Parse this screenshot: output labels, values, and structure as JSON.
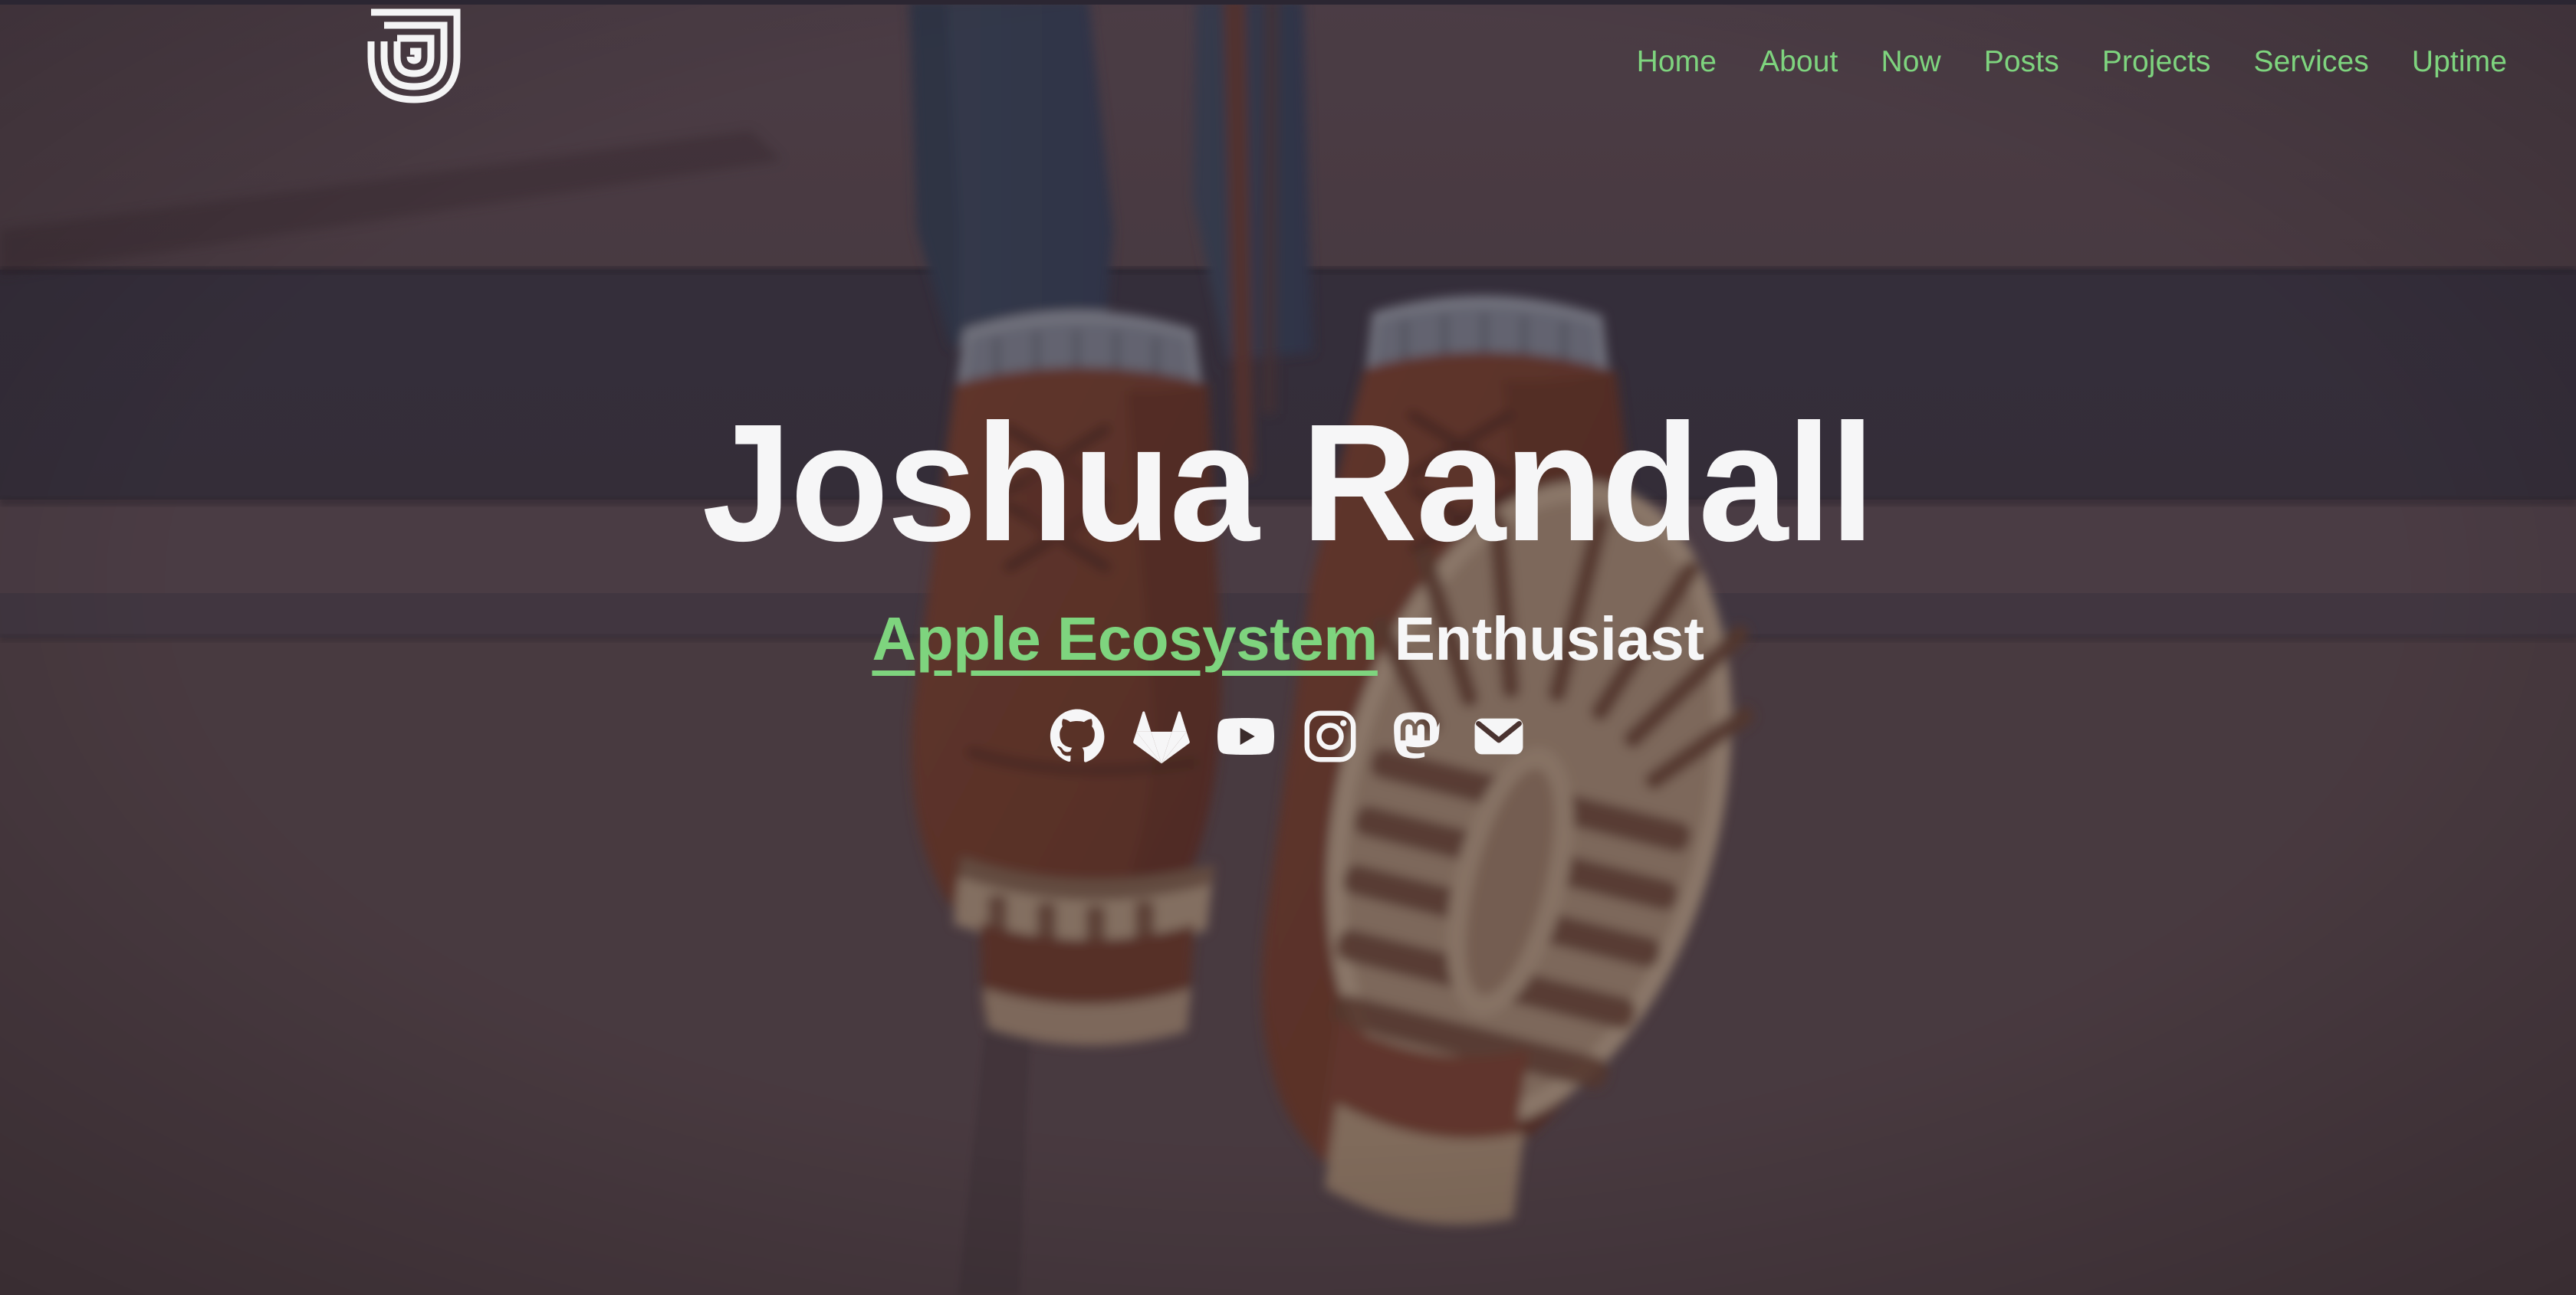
{
  "site": {
    "logo_icon": "j-monogram-logo",
    "accent_green": "#7ed47e",
    "text_white": "#f6f6f7",
    "background_overlay": "#564750"
  },
  "nav": {
    "items": [
      {
        "label": "Home"
      },
      {
        "label": "About"
      },
      {
        "label": "Now"
      },
      {
        "label": "Posts"
      },
      {
        "label": "Projects"
      },
      {
        "label": "Services"
      },
      {
        "label": "Uptime"
      }
    ]
  },
  "hero": {
    "name": "Joshua Randall",
    "tagline_link": "Apple Ecosystem",
    "tagline_rest": " Enthusiast",
    "background_description": "illustration of a person in brown boots and blue jeans sitting on concrete steps"
  },
  "social": {
    "items": [
      {
        "icon": "github-icon",
        "label": "GitHub"
      },
      {
        "icon": "gitlab-icon",
        "label": "GitLab"
      },
      {
        "icon": "youtube-icon",
        "label": "YouTube"
      },
      {
        "icon": "instagram-icon",
        "label": "Instagram"
      },
      {
        "icon": "mastodon-icon",
        "label": "Mastodon"
      },
      {
        "icon": "email-icon",
        "label": "Email"
      }
    ]
  }
}
